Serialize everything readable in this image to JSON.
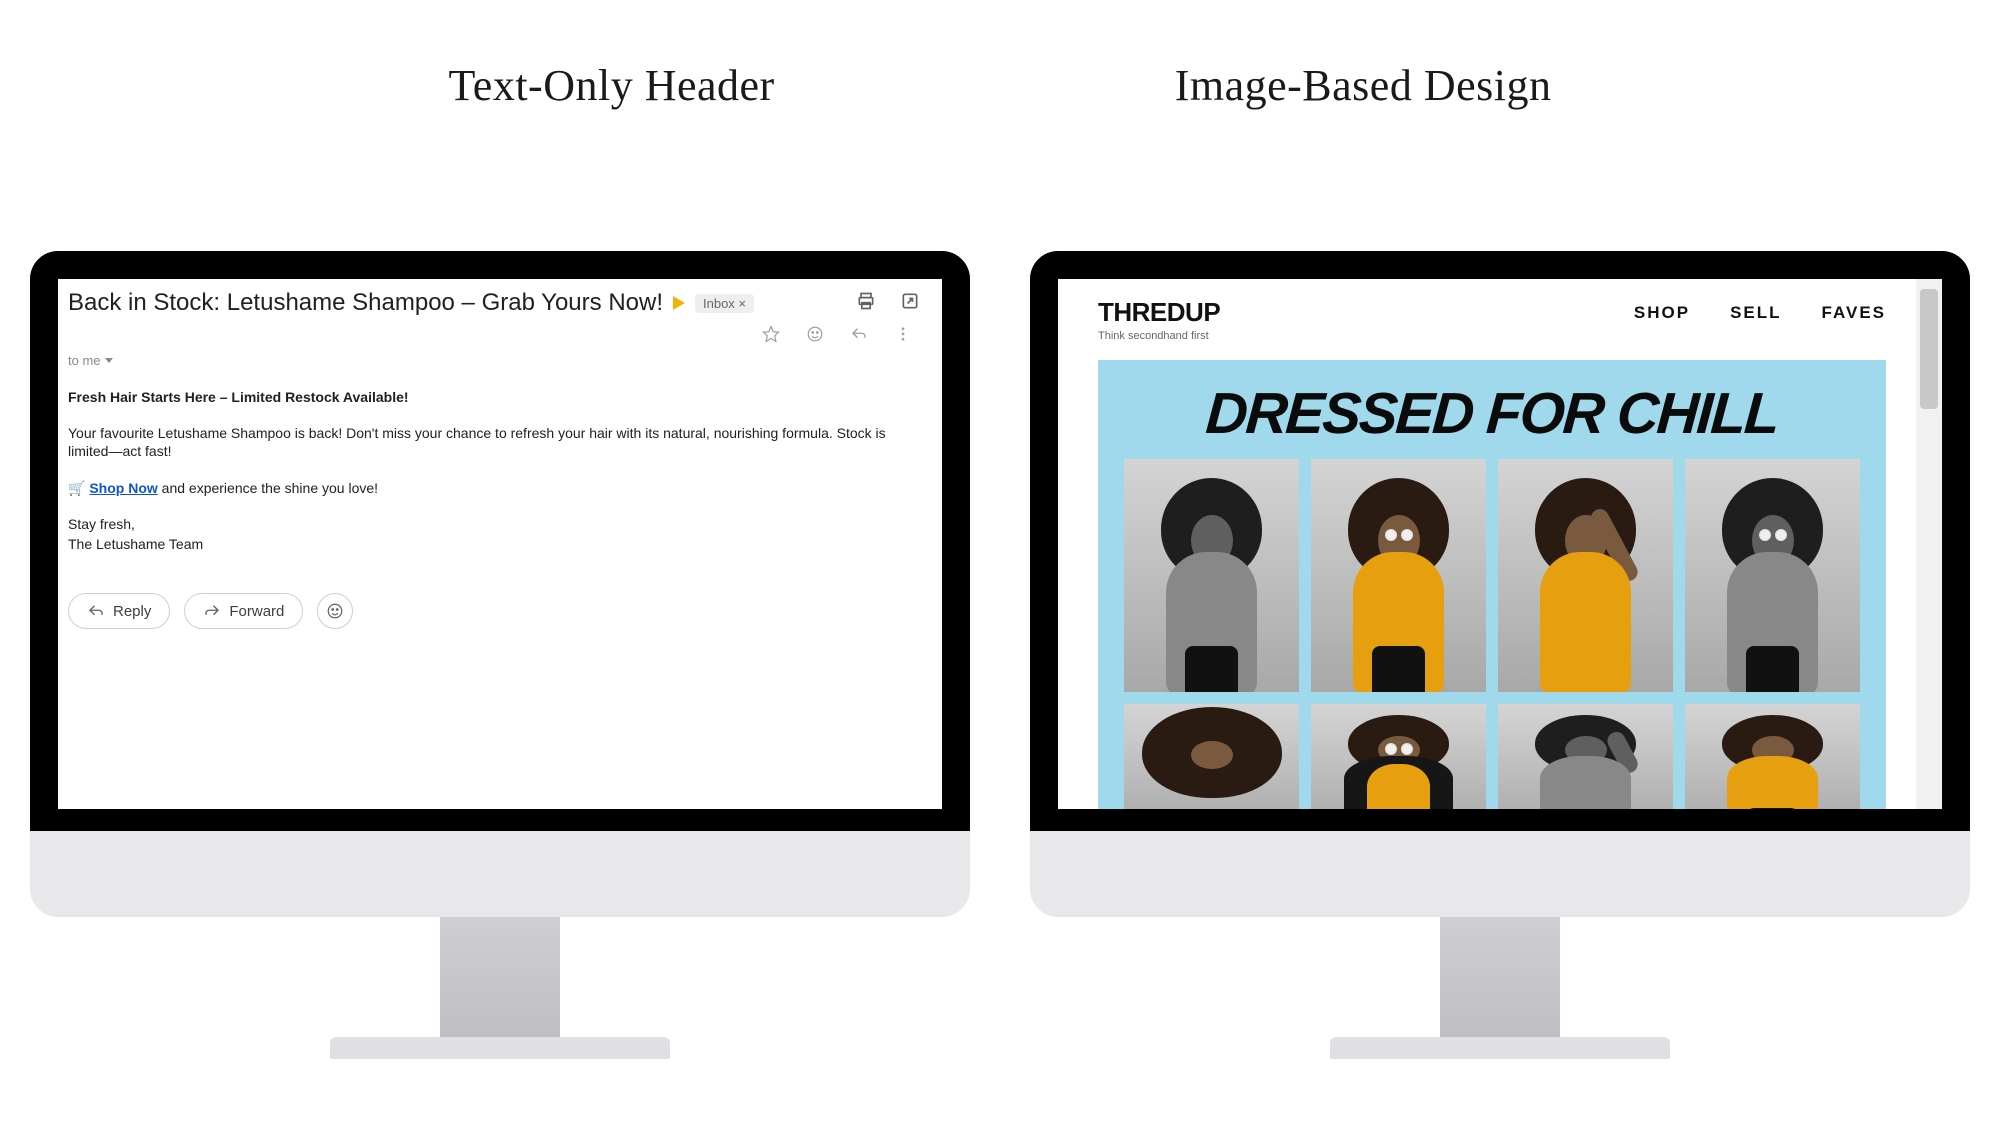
{
  "titles": {
    "left": "Text-Only Header",
    "right": "Image-Based Design"
  },
  "leftEmail": {
    "subject": "Back in Stock: Letushame Shampoo – Grab Yours Now!",
    "inboxTag": "Inbox ×",
    "toLine": "to me",
    "headline": "Fresh Hair Starts Here – Limited Restock Available!",
    "body1": "Your favourite Letushame Shampoo is back! Don't miss your chance to refresh your hair with its natural, nourishing formula. Stock is limited—act fast!",
    "cartEmoji": "🛒",
    "shopNow": "Shop Now",
    "body2_tail": " and experience the shine you love!",
    "signoff1": "Stay fresh,",
    "signoff2": "The Letushame Team",
    "replyLabel": "Reply",
    "forwardLabel": "Forward"
  },
  "rightEmail": {
    "logo": "THREDUP",
    "tagline": "Think secondhand first",
    "nav": {
      "shop": "SHOP",
      "sell": "SELL",
      "faves": "FAVES"
    },
    "headline": "DRESSED FOR CHILL"
  }
}
